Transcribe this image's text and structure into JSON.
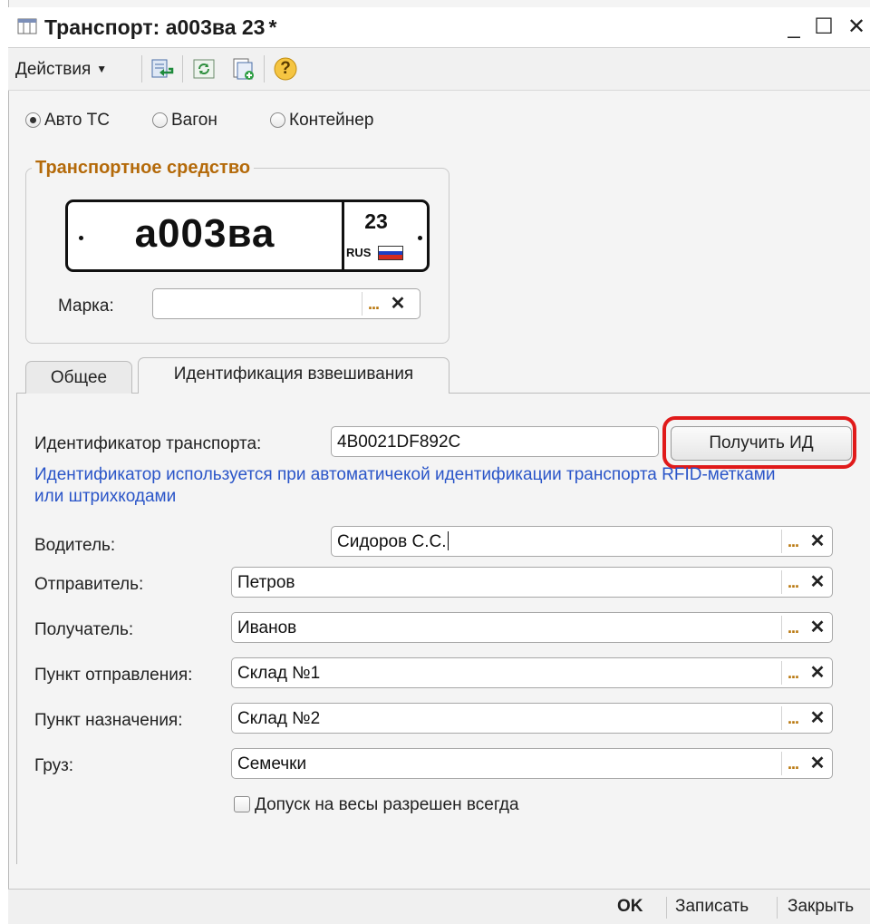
{
  "window": {
    "title": "Транспорт: а003ва 23",
    "modified_marker": "*",
    "minimize": "_",
    "maximize": "☐",
    "close": "✕"
  },
  "toolbar": {
    "actions_label": "Действия",
    "buttons": [
      "save-and-close-icon",
      "refresh-icon",
      "copy-icon",
      "help-icon"
    ],
    "help_glyph": "?"
  },
  "transport_type": {
    "options": [
      "Авто ТС",
      "Вагон",
      "Контейнер"
    ],
    "selected": "Авто ТС"
  },
  "vehicle": {
    "group_title": "Транспортное средство",
    "plate_number": "а003ва",
    "plate_region": "23",
    "plate_country": "RUS",
    "brand_label": "Марка:",
    "brand_value": ""
  },
  "tabs": [
    {
      "label": "Общее",
      "active": false
    },
    {
      "label": "Идентификация взвешивания",
      "active": true
    }
  ],
  "identification": {
    "id_label": "Идентификатор транспорта:",
    "id_value": "4B0021DF892C",
    "get_id_button": "Получить ИД",
    "hint": "Идентификатор используется при автоматичекой идентификации транспорта RFID-метками или штрихкодами"
  },
  "fields": {
    "driver": {
      "label": "Водитель:",
      "value": "Сидоров С.С."
    },
    "sender": {
      "label": "Отправитель:",
      "value": "Петров"
    },
    "recipient": {
      "label": "Получатель:",
      "value": "Иванов"
    },
    "departure": {
      "label": "Пункт отправления:",
      "value": "Склад №1"
    },
    "destination": {
      "label": "Пункт назначения:",
      "value": "Склад №2"
    },
    "cargo": {
      "label": "Груз:",
      "value": "Семечки"
    }
  },
  "field_buttons": {
    "select": "...",
    "clear": "✕"
  },
  "always_allowed": {
    "label": "Допуск на весы разрешен всегда",
    "checked": false
  },
  "bottom": {
    "ok": "OK",
    "save": "Записать",
    "close": "Закрыть"
  },
  "colors": {
    "accent": "#b46a0a",
    "hint": "#2a55c8",
    "highlight": "#e01a1a"
  }
}
